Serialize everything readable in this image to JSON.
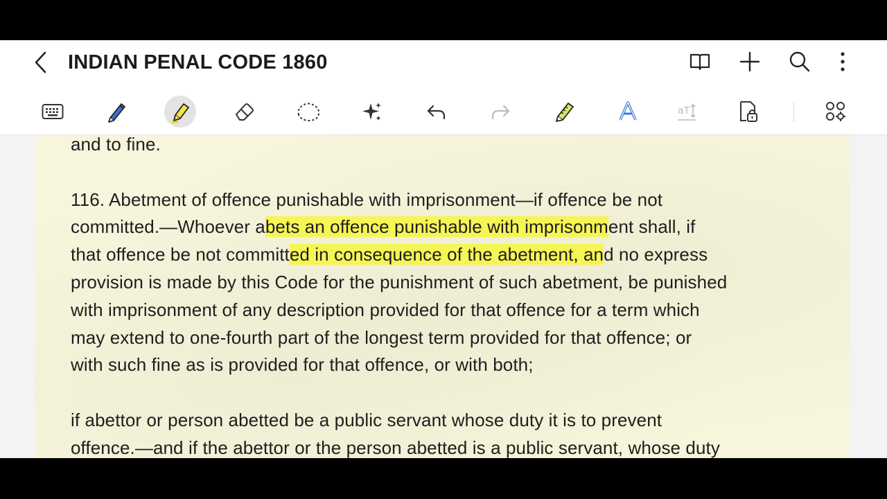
{
  "app": {
    "title": "INDIAN PENAL CODE 1860"
  },
  "titlebar_icons": [
    "back-chevron-icon",
    "book-view-icon",
    "add-icon",
    "search-icon",
    "more-vert-icon"
  ],
  "toolbar": {
    "tools": [
      "keyboard",
      "pen",
      "highlighter",
      "eraser",
      "lasso-select",
      "ai-assist",
      "undo",
      "redo",
      "ruler-pen",
      "text-style",
      "text-recognition",
      "read-only-lock",
      "more-tools"
    ],
    "active_tool": "highlighter"
  },
  "colors": {
    "page_bg": "#f7f5dc",
    "highlight": "#f6f63e",
    "pen_blue": "#3c6fd8",
    "highlighter_yellow": "#f2e34b"
  },
  "document": {
    "line1": "and to fine.",
    "section_116_line1": "116. Abetment of offence punishable with imprisonment—if offence be not",
    "section_116_line2_pre": "committed.—Whoever a",
    "section_116_line2_hl": "bets an offence punishable with imprisonm",
    "section_116_line2_post": "ent shall, if",
    "section_116_line3_pre": "that offence be not committ",
    "section_116_line3_hl": "ed in consequence of the abetment, an",
    "section_116_line3_post": "d no express",
    "section_116_line4": "provision is made by this Code for the punishment of such abetment, be punished",
    "section_116_line5": "with imprisonment of any description provided for that offence for a term which",
    "section_116_line6": "may extend to one-fourth part of the longest term provided for that offence; or",
    "section_116_line7": "with such fine as is provided for that offence, or with both;",
    "public_servant_line1": "if abettor or person abetted be a public servant whose duty it is to prevent",
    "public_servant_line2": "offence.—and if the abettor or the person abetted is a public servant, whose duty"
  }
}
